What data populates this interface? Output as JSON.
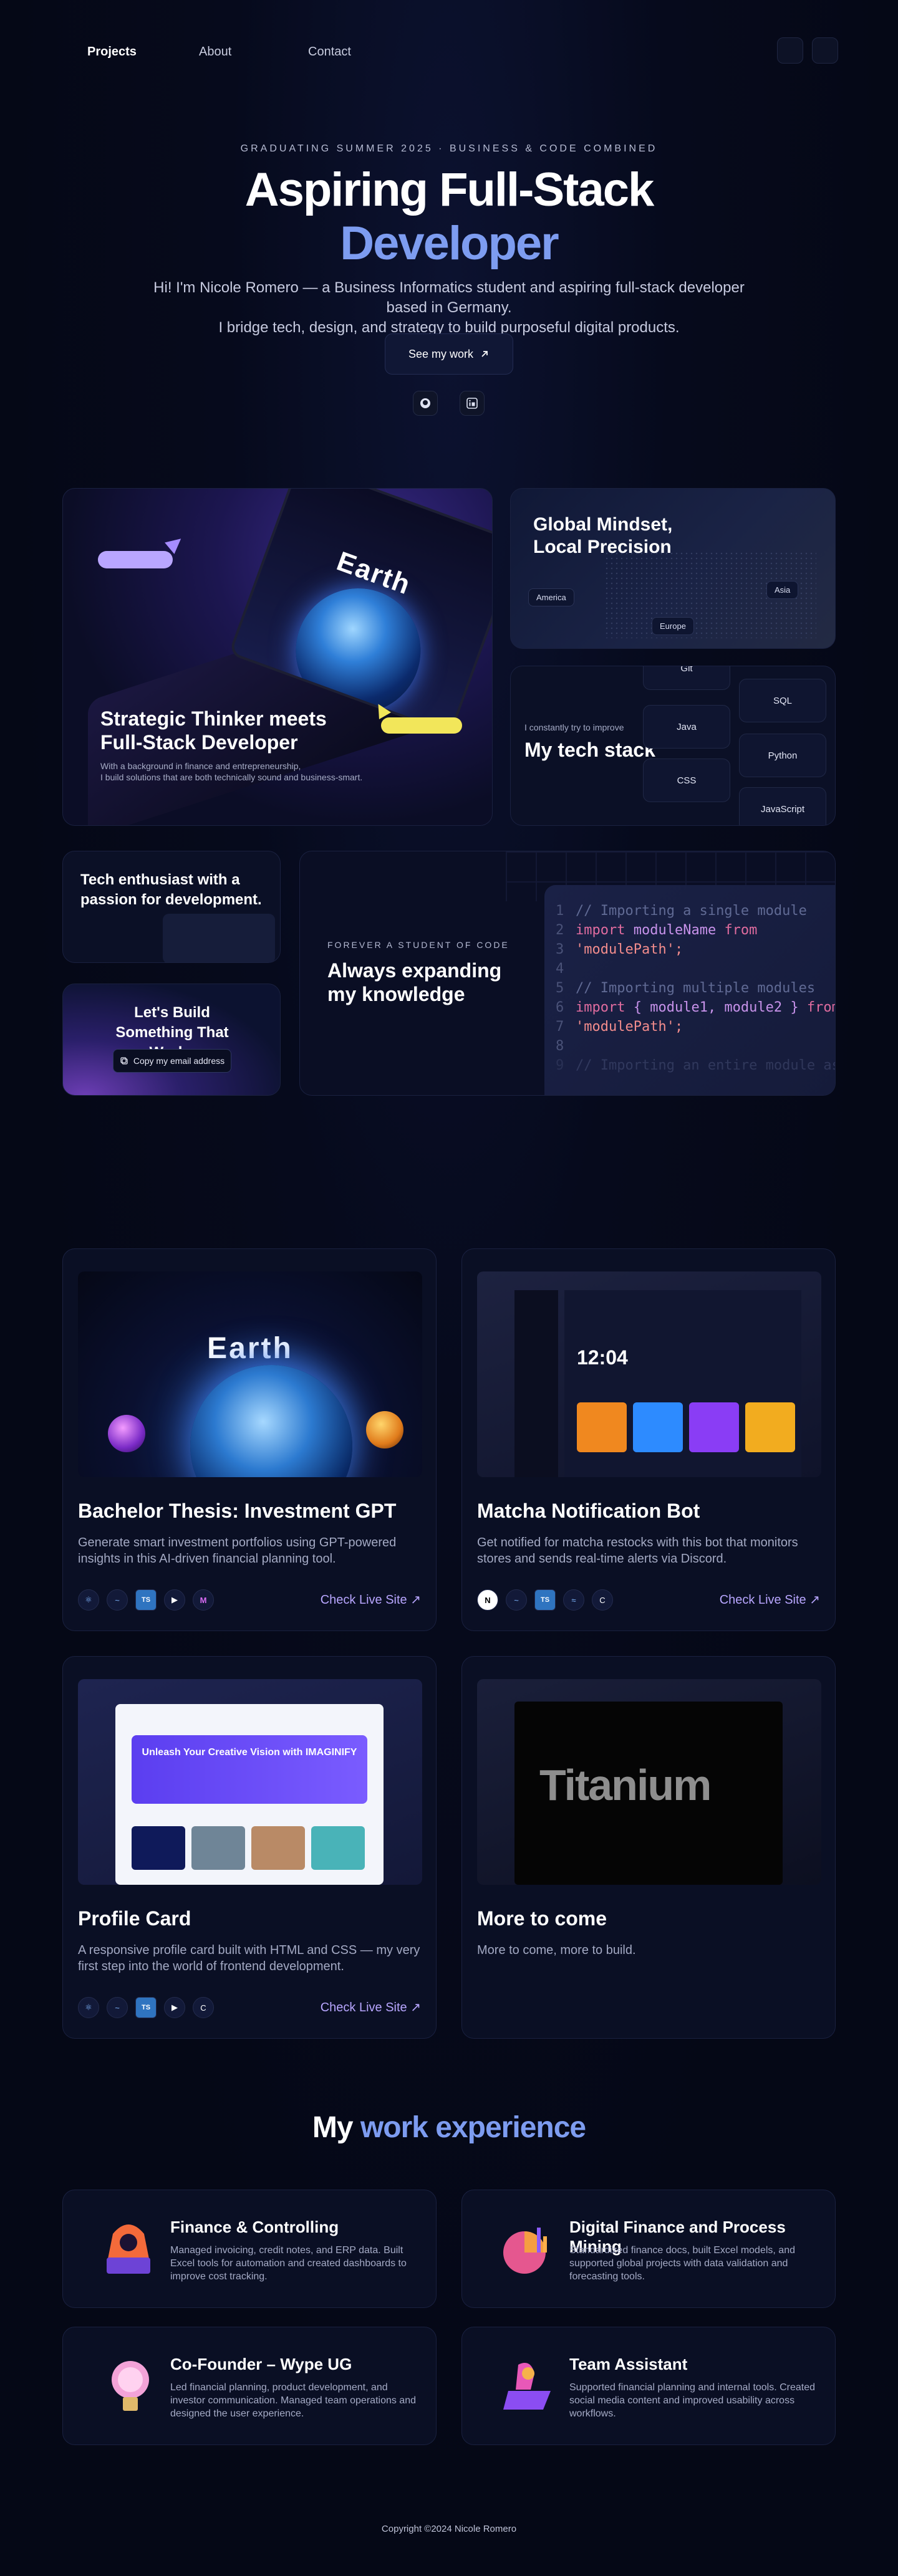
{
  "nav": {
    "links": [
      {
        "label": "Projects"
      },
      {
        "label": "About"
      },
      {
        "label": "Contact"
      }
    ]
  },
  "hero": {
    "eyebrow": "GRADUATING SUMMER 2025 · BUSINESS & CODE COMBINED",
    "title_line1": "Aspiring Full-Stack",
    "title_line2": "Developer",
    "subtitle_line1": "Hi! I'm Nicole Romero — a Business Informatics student and aspiring full-stack developer based in Germany.",
    "subtitle_line2": "I bridge tech, design, and strategy to build purposeful digital products.",
    "cta_label": "See my work",
    "cta_icon": "arrow-up-right-icon",
    "social_icons": [
      "github-icon",
      "linkedin-icon"
    ]
  },
  "bento": {
    "strategic": {
      "title": "Strategic Thinker meets Full-Stack Developer",
      "text_line1": "With a background in finance and entrepreneurship,",
      "text_line2": "I build solutions that are both technically sound and business-smart.",
      "screen_title": "Earth"
    },
    "global": {
      "title_line1": "Global Mindset,",
      "title_line2": "Local Precision",
      "regions": [
        "America",
        "Europe",
        "Asia"
      ]
    },
    "tech": {
      "small": "I constantly try to improve",
      "title": "My tech stack",
      "chips": [
        "Git",
        "Java",
        "CSS",
        "SQL",
        "Python",
        "JavaScript"
      ]
    },
    "enthusiast": {
      "title": "Tech enthusiast with a passion for development."
    },
    "build": {
      "title": "Let's Build Something That Works",
      "copy_label": "Copy my email address",
      "copy_icon": "copy-icon"
    },
    "forever": {
      "eyebrow": "FOREVER A STUDENT OF CODE",
      "title_line1": "Always expanding",
      "title_line2": "my knowledge",
      "code": {
        "line1_num": "1",
        "line1": "// Importing a single module",
        "line2_num": "2",
        "line2_kw1": "import",
        "line2_id": "moduleName",
        "line2_kw2": "from",
        "line3": "'modulePath';",
        "line3_num": "3",
        "line4_num": "4",
        "line5_num": "5",
        "line5": "// Importing multiple modules",
        "line6_num": "6",
        "line6_kw1": "import",
        "line6_id": "{ module1, module2 }",
        "line6_kw2": "from",
        "line7": "'modulePath';",
        "line7_num": "7",
        "line8_num": "8",
        "line9_num": "9",
        "line9": "// Importing an entire module as"
      }
    }
  },
  "projects": [
    {
      "title": "Bachelor Thesis: Investment GPT",
      "desc": "Generate smart investment portfolios using GPT-powered insights in this AI-driven financial planning tool.",
      "live": "Check Live Site",
      "thumb_title": "Earth",
      "icons": [
        "react-icon",
        "tailwind-icon",
        "typescript-icon",
        "framer-icon",
        "mui-icon"
      ]
    },
    {
      "title": "Matcha Notification Bot",
      "desc": "Get notified for matcha restocks with this bot that monitors stores and sends real-time alerts via Discord.",
      "live": "Check Live Site",
      "thumb_time": "12:04",
      "icons": [
        "nextjs-icon",
        "tailwind-icon",
        "typescript-icon",
        "stream-icon",
        "c-icon"
      ]
    },
    {
      "title": "Profile Card",
      "desc": "A responsive profile card built with HTML and CSS — my very first step into the world of frontend development.",
      "live": "Check Live Site",
      "thumb_banner": "Unleash Your Creative Vision with IMAGINIFY",
      "icons": [
        "react-icon",
        "tailwind-icon",
        "typescript-icon",
        "framer-icon",
        "c-icon"
      ]
    },
    {
      "title": "More to come",
      "desc": "More to come, more to build.",
      "thumb_title": "Titanium"
    }
  ],
  "experience": {
    "title_plain": "My",
    "title_highlight": "work experience",
    "items": [
      {
        "title": "Finance & Controlling",
        "desc": "Managed invoicing, credit notes, and ERP data. Built Excel tools for automation and created dashboards to improve cost tracking."
      },
      {
        "title": "Digital Finance and Process Mining",
        "desc": "Standardized finance docs, built Excel models, and supported global projects with data validation and forecasting tools."
      },
      {
        "title": "Co-Founder – Wype UG",
        "desc": "Led financial planning, product development, and investor communication. Managed team operations and designed the user experience."
      },
      {
        "title": "Team Assistant",
        "desc": "Supported financial planning and internal tools. Created social media content and improved usability across workflows."
      }
    ]
  },
  "footer": "Copyright ©2024 Nicole Romero",
  "colors": {
    "background": "#050816",
    "accent": "#7d9cf0",
    "link": "#b8a6ff"
  }
}
